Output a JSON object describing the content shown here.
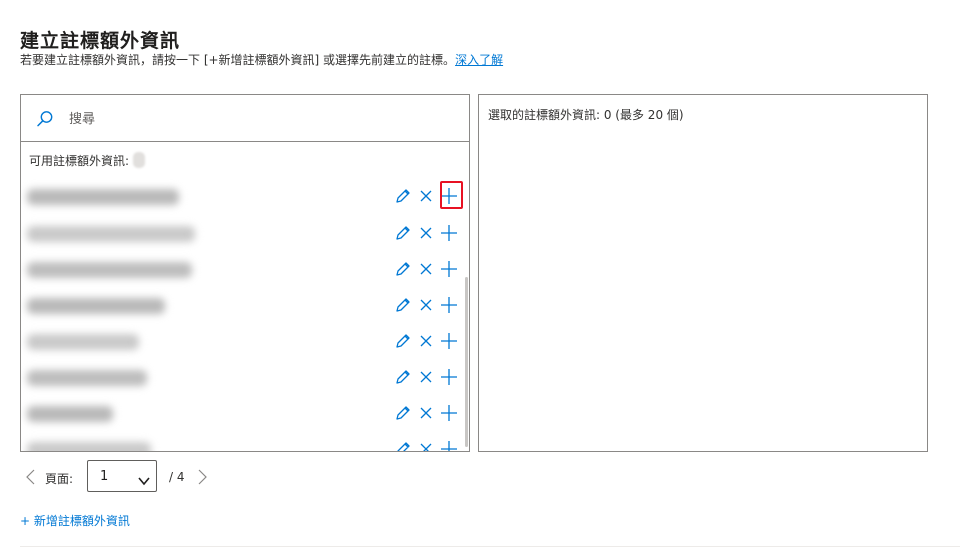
{
  "header": {
    "title": "建立註標額外資訊",
    "subtitle": "若要建立註標額外資訊，請按一下 [+新增註標額外資訊] 或選擇先前建立的註標。",
    "learn_more": "深入了解"
  },
  "search": {
    "placeholder": "搜尋",
    "value": "",
    "icon": "search-icon"
  },
  "available": {
    "label": "可用註標額外資訊:",
    "items": [
      {
        "action_icons": [
          "edit-icon",
          "close-icon",
          "add-icon"
        ],
        "highlighted": true
      },
      {
        "action_icons": [
          "edit-icon",
          "close-icon",
          "add-icon"
        ]
      },
      {
        "action_icons": [
          "edit-icon",
          "close-icon",
          "add-icon"
        ]
      },
      {
        "action_icons": [
          "edit-icon",
          "close-icon",
          "add-icon"
        ]
      },
      {
        "action_icons": [
          "edit-icon",
          "close-icon",
          "add-icon"
        ]
      },
      {
        "action_icons": [
          "edit-icon",
          "close-icon",
          "add-icon"
        ]
      },
      {
        "action_icons": [
          "edit-icon",
          "close-icon",
          "add-icon"
        ]
      },
      {
        "action_icons": [
          "edit-icon",
          "close-icon",
          "add-icon"
        ]
      }
    ]
  },
  "selected": {
    "label": "選取的註標額外資訊: 0 (最多 20 個)"
  },
  "pager": {
    "page_label": "頁面:",
    "current_page": "1",
    "total": "/ 4"
  },
  "add_link": "+ 新增註標額外資訊",
  "colors": {
    "accent": "#0078d4",
    "highlight": "#e81123",
    "border": "#8a8886"
  }
}
